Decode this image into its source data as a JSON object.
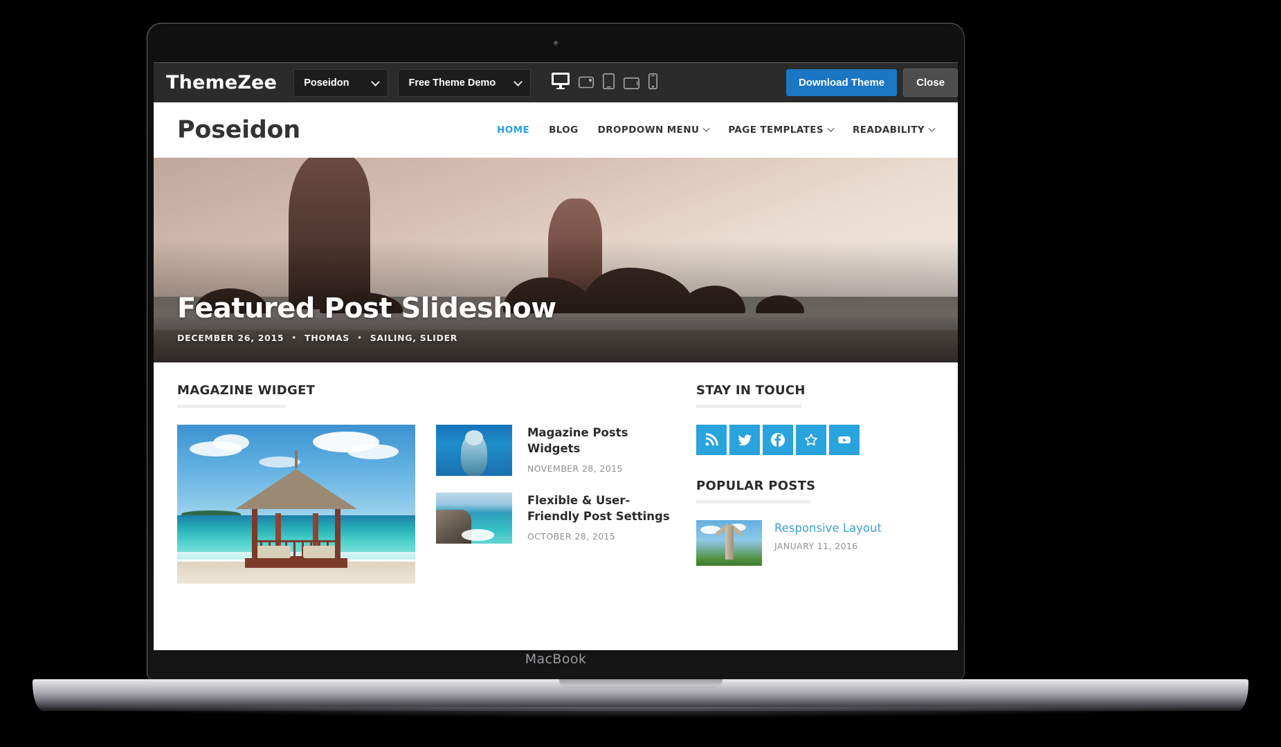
{
  "device": {
    "label": "MacBook"
  },
  "theme_bar": {
    "brand": "ThemeZee",
    "theme_select": {
      "value": "Poseidon"
    },
    "demo_select": {
      "value": "Free Theme Demo"
    },
    "devices": [
      {
        "name": "desktop",
        "active": true
      },
      {
        "name": "laptop",
        "active": false
      },
      {
        "name": "tablet-portrait",
        "active": false
      },
      {
        "name": "tablet-landscape",
        "active": false
      },
      {
        "name": "mobile",
        "active": false
      }
    ],
    "download_label": "Download Theme",
    "close_label": "Close",
    "accent": "#1b77c4"
  },
  "site": {
    "title": "Poseidon",
    "nav": [
      {
        "label": "HOME",
        "active": true,
        "dropdown": false
      },
      {
        "label": "BLOG",
        "active": false,
        "dropdown": false
      },
      {
        "label": "DROPDOWN MENU",
        "active": false,
        "dropdown": true
      },
      {
        "label": "PAGE TEMPLATES",
        "active": false,
        "dropdown": true
      },
      {
        "label": "READABILITY",
        "active": false,
        "dropdown": true
      }
    ],
    "accent": "#29a3dc"
  },
  "hero": {
    "title": "Featured Post Slideshow",
    "date": "DECEMBER 26, 2015",
    "sep1": "•",
    "author": "THOMAS",
    "sep2": "•",
    "categories": "SAILING, SLIDER"
  },
  "magazine_widget": {
    "title": "MAGAZINE WIDGET",
    "feature_image_alt": "tropical-beach-hut",
    "posts": [
      {
        "title": "Magazine Posts Widgets",
        "date": "NOVEMBER 28, 2015",
        "thumb": "dolphin"
      },
      {
        "title": "Flexible & User-Friendly Post Settings",
        "date": "OCTOBER 28, 2015",
        "thumb": "cliff"
      }
    ]
  },
  "stay_in_touch": {
    "title": "STAY IN TOUCH",
    "links": [
      {
        "name": "rss",
        "color": "#29a3dc"
      },
      {
        "name": "twitter",
        "color": "#29a3dc"
      },
      {
        "name": "facebook",
        "color": "#29a3dc"
      },
      {
        "name": "star",
        "color": "#29a3dc"
      },
      {
        "name": "youtube",
        "color": "#29a3dc"
      }
    ]
  },
  "popular_posts": {
    "title": "POPULAR POSTS",
    "posts": [
      {
        "title": "Responsive Layout",
        "date": "JANUARY 11, 2016",
        "thumb": "totem"
      }
    ]
  }
}
